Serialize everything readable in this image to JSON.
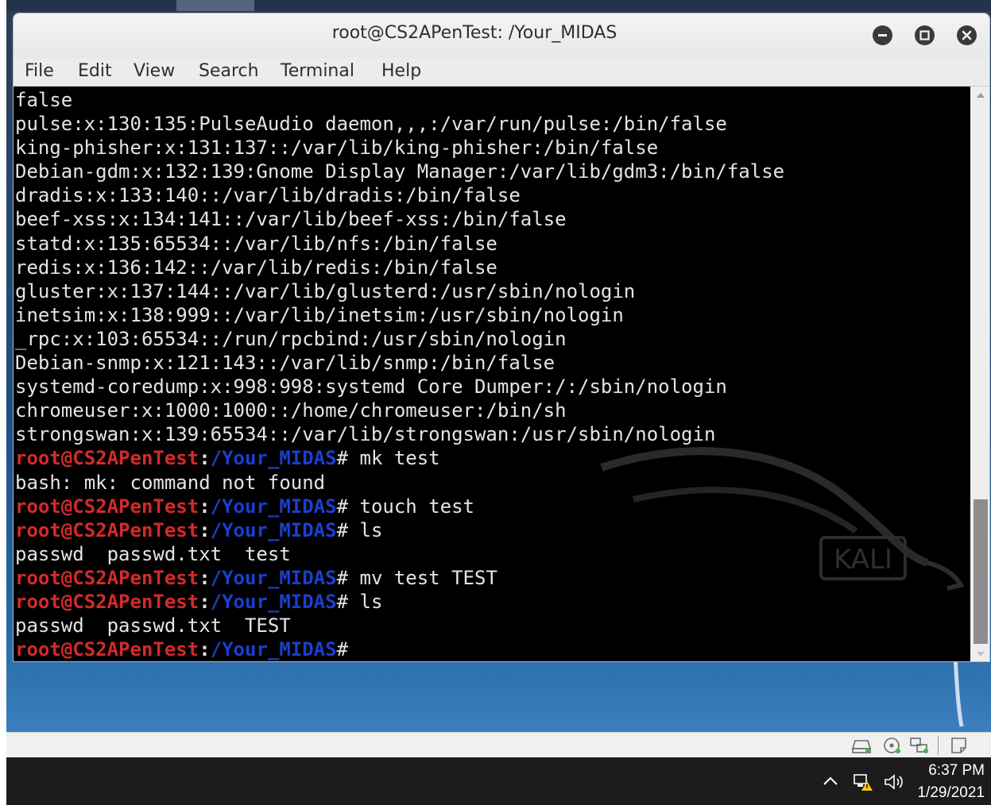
{
  "window": {
    "title": "root@CS2APenTest: /Your_MIDAS"
  },
  "menu": [
    {
      "label": "File"
    },
    {
      "label": "Edit"
    },
    {
      "label": "View"
    },
    {
      "label": "Search"
    },
    {
      "label": "Terminal"
    },
    {
      "label": "Help"
    }
  ],
  "prompt": {
    "user_host": "root@CS2APenTest",
    "colon": ":",
    "path": "/Your_MIDAS",
    "symbol": "#"
  },
  "terminal": {
    "lines": [
      {
        "text": "false"
      },
      {
        "text": "pulse:x:130:135:PulseAudio daemon,,,:/var/run/pulse:/bin/false"
      },
      {
        "text": "king-phisher:x:131:137::/var/lib/king-phisher:/bin/false"
      },
      {
        "text": "Debian-gdm:x:132:139:Gnome Display Manager:/var/lib/gdm3:/bin/false"
      },
      {
        "text": "dradis:x:133:140::/var/lib/dradis:/bin/false"
      },
      {
        "text": "beef-xss:x:134:141::/var/lib/beef-xss:/bin/false"
      },
      {
        "text": "statd:x:135:65534::/var/lib/nfs:/bin/false"
      },
      {
        "text": "redis:x:136:142::/var/lib/redis:/bin/false"
      },
      {
        "text": "gluster:x:137:144::/var/lib/glusterd:/usr/sbin/nologin"
      },
      {
        "text": "inetsim:x:138:999::/var/lib/inetsim:/usr/sbin/nologin"
      },
      {
        "text": "_rpc:x:103:65534::/run/rpcbind:/usr/sbin/nologin"
      },
      {
        "text": "Debian-snmp:x:121:143::/var/lib/snmp:/bin/false"
      },
      {
        "text": "systemd-coredump:x:998:998:systemd Core Dumper:/:/sbin/nologin"
      },
      {
        "text": "chromeuser:x:1000:1000::/home/chromeuser:/bin/sh"
      },
      {
        "text": "strongswan:x:139:65534::/var/lib/strongswan:/usr/sbin/nologin"
      },
      {
        "prompt": true,
        "cmd": " mk test"
      },
      {
        "text": "bash: mk: command not found"
      },
      {
        "prompt": true,
        "cmd": " touch test"
      },
      {
        "prompt": true,
        "cmd": " ls"
      },
      {
        "text": "passwd  passwd.txt  test"
      },
      {
        "prompt": true,
        "cmd": " mv test TEST"
      },
      {
        "prompt": true,
        "cmd": " ls"
      },
      {
        "text": "passwd  passwd.txt  TEST"
      },
      {
        "prompt": true,
        "cmd": ""
      }
    ]
  },
  "watermark": {
    "text": "KALI"
  },
  "taskbar": {
    "time": "6:37 PM",
    "date": "1/29/2021"
  },
  "colors": {
    "prompt_user": "#d42a2a",
    "prompt_path": "#1b3fcc",
    "terminal_bg": "#000000",
    "terminal_fg": "#e4e4e4",
    "taskbar_bg": "#1c1c1c"
  }
}
